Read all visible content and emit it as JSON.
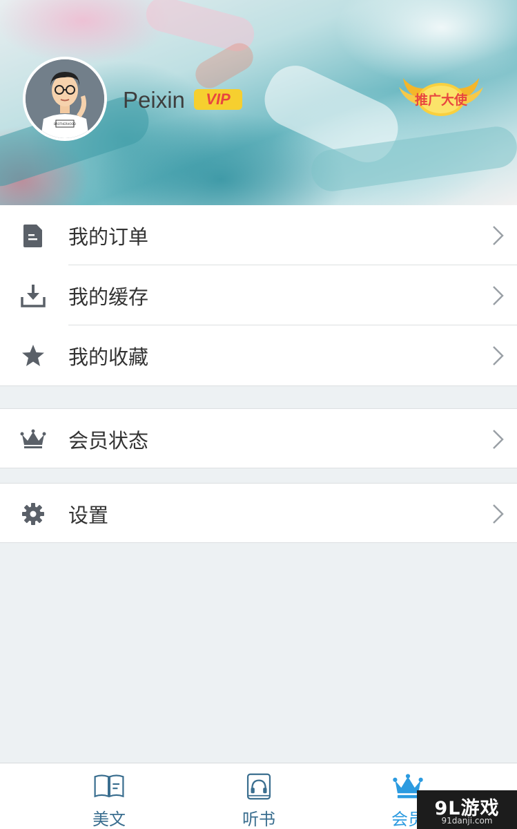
{
  "profile": {
    "username": "Peixin",
    "vip_label": "VIP",
    "ambassador_label": "推广大使",
    "avatar_shirt_text": "BROTHERHOOD"
  },
  "menu": {
    "group1": [
      {
        "label": "我的订单",
        "icon": "document-icon"
      },
      {
        "label": "我的缓存",
        "icon": "download-icon"
      },
      {
        "label": "我的收藏",
        "icon": "star-icon"
      }
    ],
    "group2": [
      {
        "label": "会员状态",
        "icon": "crown-icon"
      }
    ],
    "group3": [
      {
        "label": "设置",
        "icon": "gear-icon"
      }
    ]
  },
  "tabbar": {
    "tabs": [
      {
        "label": "美文",
        "icon": "book-icon"
      },
      {
        "label": "听书",
        "icon": "headphones-book-icon"
      },
      {
        "label": "会员",
        "icon": "crown-icon",
        "active": true
      }
    ]
  },
  "watermark": {
    "main": "9L游戏",
    "sub": "91danji.com"
  },
  "colors": {
    "accent": "#2c9be0",
    "icon_gray": "#5a6068",
    "vip_badge": "#f6cf2f",
    "vip_text": "#e8463f",
    "background": "#edf1f3"
  }
}
